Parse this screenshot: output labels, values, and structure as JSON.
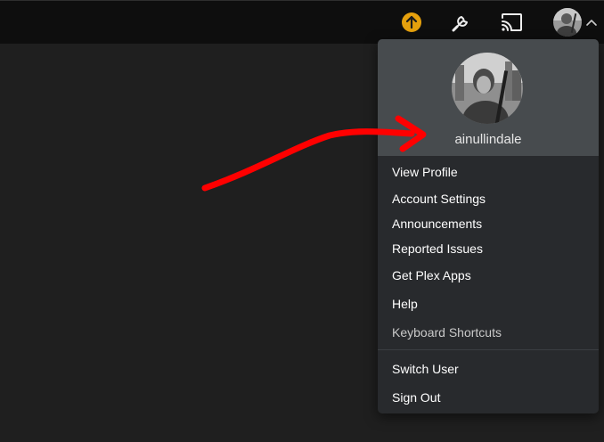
{
  "topbar": {
    "icons": {
      "upgrade": "arrow-up-circle-icon",
      "settings": "wrench-icon",
      "cast": "cast-icon",
      "user": "user-avatar",
      "chevron": "chevron-up-icon"
    },
    "colors": {
      "upgrade_accent": "#e5a00d",
      "background": "#0e0e0e"
    }
  },
  "menu": {
    "username": "ainullindale",
    "items": [
      {
        "label": "View Profile"
      },
      {
        "label": "Account Settings"
      },
      {
        "label": "Announcements"
      },
      {
        "label": "Reported Issues"
      },
      {
        "label": "Get Plex Apps"
      },
      {
        "label": "Help"
      },
      {
        "label": "Keyboard Shortcuts"
      }
    ],
    "secondary_items": [
      {
        "label": "Switch User"
      },
      {
        "label": "Sign Out"
      }
    ],
    "colors": {
      "header_background": "#474b4e",
      "body_background": "#282a2d"
    }
  },
  "annotation": {
    "color": "#ff0000",
    "shape": "arrow"
  }
}
